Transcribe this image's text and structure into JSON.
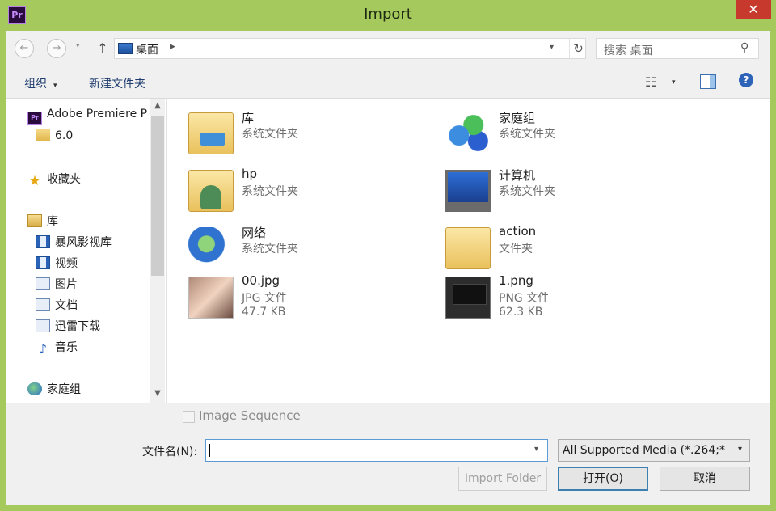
{
  "window": {
    "title": "Import",
    "app_icon_text": "Pr",
    "close_glyph": "✕"
  },
  "nav": {
    "back_glyph": "←",
    "forward_glyph": "→",
    "dropdown_glyph": "▾",
    "up_glyph": "↑"
  },
  "address": {
    "location": "桌面",
    "arrow_glyph": "▶",
    "dropdown_glyph": "▾",
    "refresh_glyph": "↻"
  },
  "search": {
    "placeholder": "搜索 桌面",
    "icon_glyph": "⚲"
  },
  "toolbar": {
    "organize_label": "组织",
    "new_folder_label": "新建文件夹",
    "caret_glyph": "▾",
    "view_glyph": "☷",
    "help_glyph": "?"
  },
  "sidebar": {
    "items": [
      {
        "label": "Adobe Premiere P",
        "icon": "premiere-icon"
      },
      {
        "label": "6.0",
        "icon": "folder-icon"
      },
      {
        "label": "收藏夹",
        "icon": "star-icon"
      },
      {
        "label": "库",
        "icon": "library-icon"
      },
      {
        "label": "暴风影视库",
        "icon": "video-library-icon"
      },
      {
        "label": "视频",
        "icon": "video-icon"
      },
      {
        "label": "图片",
        "icon": "pictures-icon"
      },
      {
        "label": "文档",
        "icon": "documents-icon"
      },
      {
        "label": "迅雷下载",
        "icon": "download-icon"
      },
      {
        "label": "音乐",
        "icon": "music-icon"
      },
      {
        "label": "家庭组",
        "icon": "homegroup-icon"
      }
    ],
    "star_glyph": "★",
    "music_glyph": "♪",
    "scroll_up_glyph": "▲",
    "scroll_down_glyph": "▼"
  },
  "files": [
    {
      "name": "库",
      "type": "系统文件夹",
      "size": "",
      "icon": "library-icon"
    },
    {
      "name": "家庭组",
      "type": "系统文件夹",
      "size": "",
      "icon": "homegroup-icon"
    },
    {
      "name": "hp",
      "type": "系统文件夹",
      "size": "",
      "icon": "user-folder-icon"
    },
    {
      "name": "计算机",
      "type": "系统文件夹",
      "size": "",
      "icon": "computer-icon"
    },
    {
      "name": "网络",
      "type": "系统文件夹",
      "size": "",
      "icon": "network-icon"
    },
    {
      "name": "action",
      "type": "文件夹",
      "size": "",
      "icon": "folder-icon"
    },
    {
      "name": "00.jpg",
      "type": "JPG 文件",
      "size": "47.7 KB",
      "icon": "jpg-thumbnail"
    },
    {
      "name": "1.png",
      "type": "PNG 文件",
      "size": "62.3 KB",
      "icon": "png-thumbnail"
    }
  ],
  "footer": {
    "image_sequence_label": "Image Sequence",
    "image_sequence_checked": false,
    "filename_label": "文件名(N):",
    "filename_value": "",
    "filename_dropdown_glyph": "▾",
    "filter_value": "All Supported Media (*.264;*",
    "filter_dropdown_glyph": "▾",
    "import_folder_label": "Import Folder",
    "open_label": "打开(O)",
    "cancel_label": "取消"
  },
  "colors": {
    "frame": "#a6c95d",
    "close": "#c7392c",
    "link": "#1e3c6e",
    "focus": "#5b9bd5"
  }
}
